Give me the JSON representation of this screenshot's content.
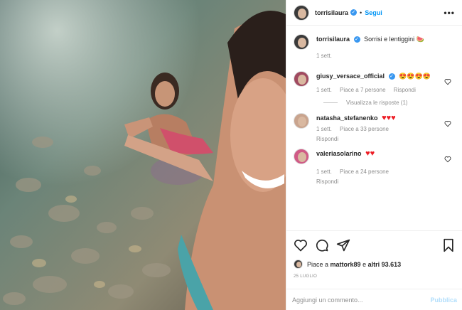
{
  "header": {
    "username": "torrisilaura",
    "separator": "•",
    "follow_label": "Segui",
    "more_label": "•••"
  },
  "caption": {
    "username": "torrisilaura",
    "text": "Sorrisi e lentiggini",
    "emoji": "🍉",
    "time": "1 sett."
  },
  "comments": [
    {
      "username": "giusy_versace_official",
      "text": "😍😍😍😍",
      "time": "1 sett.",
      "likes": "Piace a 7 persone",
      "reply_label": "Rispondi",
      "view_replies": "Visualizza le risposte (1)"
    },
    {
      "username": "natasha_stefanenko",
      "text": "♥♥♥",
      "time": "1 sett.",
      "likes": "Piace a 33 persone",
      "reply_label": "Rispondi"
    },
    {
      "username": "valeriasolarino",
      "text": "♥♥",
      "time": "1 sett.",
      "likes": "Piace a 24 persone",
      "reply_label": "Rispondi"
    }
  ],
  "actions": {
    "likes_prefix": "Piace a",
    "likes_user": "mattork89",
    "likes_and": "e",
    "likes_others": "altri 93.613",
    "date": "25 LUGLIO"
  },
  "add_comment": {
    "placeholder": "Aggiungi un commento...",
    "publish_label": "Pubblica"
  },
  "colors": {
    "accent": "#0095f6",
    "verified": "#3897f0",
    "muted": "#8e8e8e",
    "heart": "#ed1c24"
  },
  "icons": [
    "heart-icon",
    "comment-icon",
    "share-icon",
    "bookmark-icon",
    "more-icon",
    "verified-icon"
  ]
}
